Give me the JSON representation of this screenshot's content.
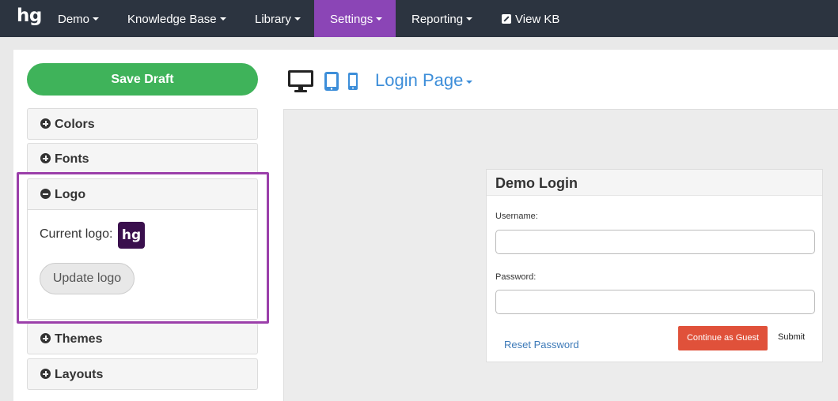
{
  "nav": {
    "brand": "hg",
    "items": [
      {
        "label": "Demo",
        "dropdown": true
      },
      {
        "label": "Knowledge Base",
        "dropdown": true
      },
      {
        "label": "Library",
        "dropdown": true
      },
      {
        "label": "Settings",
        "dropdown": true,
        "active": true
      },
      {
        "label": "Reporting",
        "dropdown": true
      },
      {
        "label": "View KB",
        "icon": "external-link-icon"
      }
    ]
  },
  "sidebar": {
    "save_label": "Save Draft",
    "sections": [
      {
        "label": "Colors",
        "state": "collapsed"
      },
      {
        "label": "Fonts",
        "state": "collapsed"
      },
      {
        "label": "Logo",
        "state": "expanded"
      },
      {
        "label": "Themes",
        "state": "collapsed"
      },
      {
        "label": "Layouts",
        "state": "collapsed"
      }
    ],
    "logo": {
      "current_label": "Current logo:",
      "logo_text": "hg",
      "update_label": "Update logo"
    }
  },
  "preview": {
    "devices": [
      "desktop-icon",
      "tablet-icon",
      "phone-icon"
    ],
    "page_select": "Login Page",
    "login": {
      "title": "Demo Login",
      "username_label": "Username:",
      "password_label": "Password:",
      "reset_label": "Reset Password",
      "guest_label": "Continue as Guest",
      "submit_label": "Submit"
    }
  },
  "colors": {
    "nav_bg": "#2c3440",
    "nav_active": "#8b45b6",
    "save_green": "#3fb35a",
    "logo_purple": "#3a0f4d",
    "highlight": "#9b3faa",
    "link_blue": "#3d8ed9",
    "guest_red": "#e0513a"
  }
}
